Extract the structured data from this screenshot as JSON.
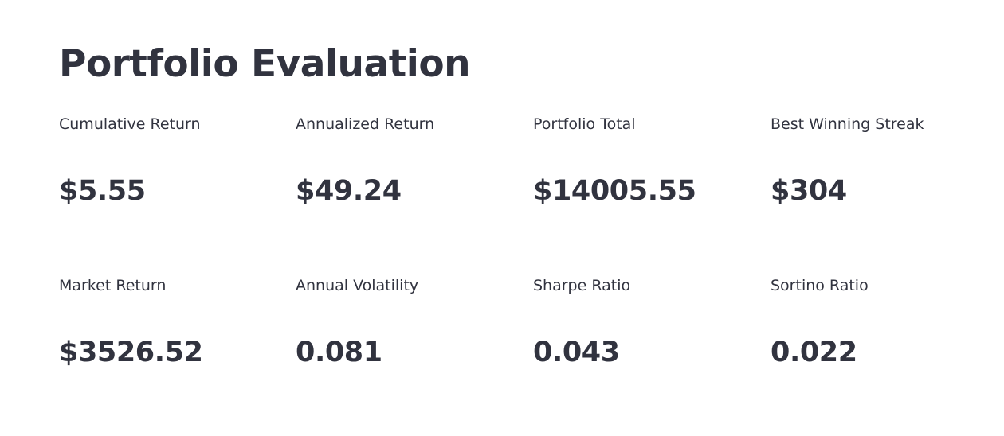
{
  "title": "Portfolio Evaluation",
  "metrics": [
    {
      "label": "Cumulative Return",
      "value": "$5.55"
    },
    {
      "label": "Annualized Return",
      "value": "$49.24"
    },
    {
      "label": "Portfolio Total",
      "value": "$14005.55"
    },
    {
      "label": "Best Winning Streak",
      "value": "$304"
    },
    {
      "label": "Market Return",
      "value": "$3526.52"
    },
    {
      "label": "Annual Volatility",
      "value": "0.081"
    },
    {
      "label": "Sharpe Ratio",
      "value": "0.043"
    },
    {
      "label": "Sortino Ratio",
      "value": "0.022"
    }
  ],
  "colors": {
    "text": "#31333f",
    "background": "#ffffff"
  }
}
